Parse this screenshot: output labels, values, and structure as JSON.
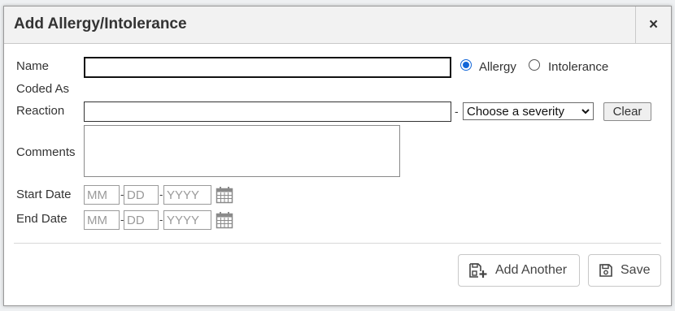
{
  "dialog": {
    "title": "Add Allergy/Intolerance",
    "close_icon": "×"
  },
  "form": {
    "name_label": "Name",
    "name_value": "",
    "type_options": [
      {
        "label": "Allergy",
        "checked": true
      },
      {
        "label": "Intolerance",
        "checked": false
      }
    ],
    "coded_as_label": "Coded As",
    "reaction_label": "Reaction",
    "reaction_value": "",
    "severity_separator": "-",
    "severity_select": "Choose a severity",
    "clear_label": "Clear",
    "comments_label": "Comments",
    "comments_value": "",
    "start_date_label": "Start Date",
    "end_date_label": "End Date",
    "date_placeholders": {
      "month": "MM",
      "day": "DD",
      "year": "YYYY"
    },
    "date_separator": "-",
    "calendar_icon": "calendar-icon"
  },
  "footer": {
    "add_another_label": "Add Another",
    "save_label": "Save",
    "add_another_icon": "save-plus-icon",
    "save_icon": "floppy-disk-icon"
  }
}
